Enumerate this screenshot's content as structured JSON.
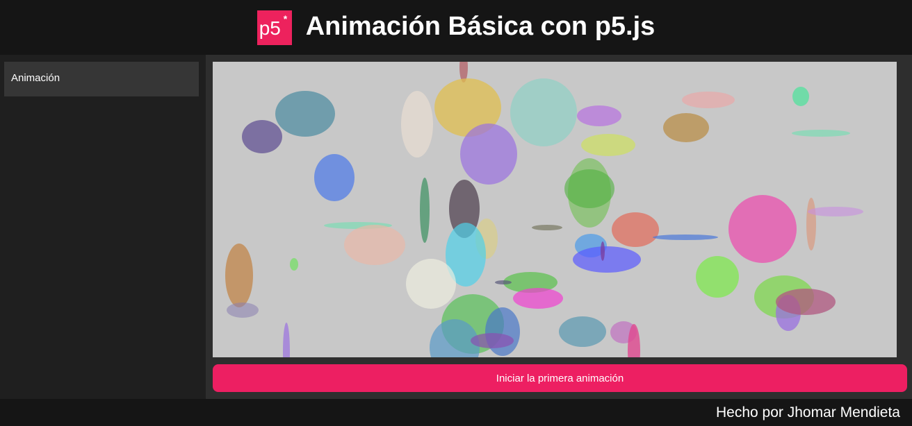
{
  "header": {
    "logo_text": "p5",
    "logo_star": "*",
    "title": "Animación Básica con p5.js"
  },
  "sidebar": {
    "items": [
      {
        "label": "Animación"
      }
    ]
  },
  "main": {
    "start_button_label": "Iniciar la primera animación"
  },
  "footer": {
    "credit": "Hecho por Jhomar Mendieta"
  },
  "colors": {
    "accent": "#ed225d",
    "button": "#ed1f62",
    "canvas_background": "#c8c8c8"
  }
}
